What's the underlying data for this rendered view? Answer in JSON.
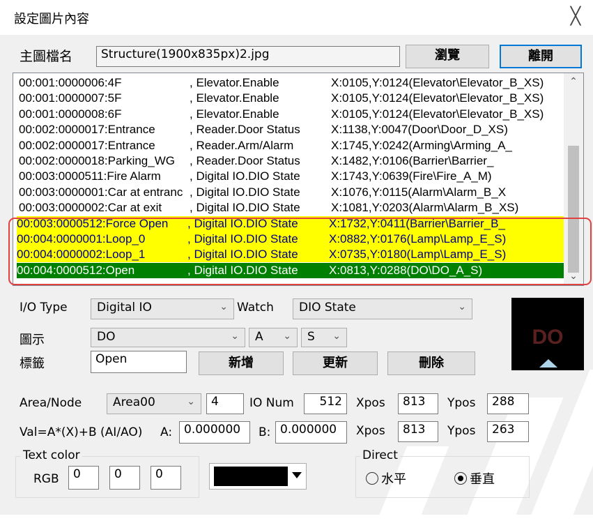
{
  "window": {
    "title": "設定圖片內容",
    "close_glyph": "╳"
  },
  "main_file": {
    "label": "主圖檔名",
    "value": "Structure(1900x835px)2.jpg",
    "browse_label": "瀏覽",
    "exit_label": "離開"
  },
  "list": {
    "rows": [
      {
        "id": "00:001:0000006:4F",
        "type": ", Elevator.Enable",
        "pos": "X:0105,Y:0124(Elevator\\Elevator_B_XS)",
        "style": "normal"
      },
      {
        "id": "00:001:0000007:5F",
        "type": ", Elevator.Enable",
        "pos": "X:0105,Y:0124(Elevator\\Elevator_B_XS)",
        "style": "normal"
      },
      {
        "id": "00:001:0000008:6F",
        "type": ", Elevator.Enable",
        "pos": "X:0105,Y:0124(Elevator\\Elevator_B_XS)",
        "style": "normal"
      },
      {
        "id": "00:002:0000017:Entrance",
        "type": ", Reader.Door Status",
        "pos": "X:1138,Y:0047(Door\\Door_D_XS)",
        "style": "normal"
      },
      {
        "id": "00:002:0000017:Entrance",
        "type": ", Reader.Arm/Alarm",
        "pos": "X:1745,Y:0242(Arming\\Arming_A_",
        "style": "normal"
      },
      {
        "id": "00:002:0000018:Parking_WG",
        "type": ", Reader.Door Status",
        "pos": "X:1482,Y:0106(Barrier\\Barrier_",
        "style": "normal"
      },
      {
        "id": "00:003:0000511:Fire Alarm",
        "type": ", Digital IO.DIO State",
        "pos": "X:1743,Y:0639(Fire\\Fire_A_M)",
        "style": "normal"
      },
      {
        "id": "00:003:0000001:Car at entranc",
        "type": ", Digital IO.DIO State",
        "pos": "X:1076,Y:0115(Alarm\\Alarm_B_X",
        "style": "normal"
      },
      {
        "id": "00:003:0000002:Car at exit",
        "type": ", Digital IO.DIO State",
        "pos": "X:1081,Y:0203(Alarm\\Alarm_B_XS)",
        "style": "normal"
      },
      {
        "id": "00:003:0000512:Force Open",
        "type": ", Digital IO.DIO State",
        "pos": "X:1732,Y:0411(Barrier\\Barrier_B_",
        "style": "yellow"
      },
      {
        "id": "00:004:0000001:Loop_0",
        "type": ", Digital IO.DIO State",
        "pos": "X:0882,Y:0176(Lamp\\Lamp_E_S)",
        "style": "yellow"
      },
      {
        "id": "00:004:0000002:Loop_1",
        "type": ", Digital IO.DIO State",
        "pos": "X:0735,Y:0180(Lamp\\Lamp_E_S)",
        "style": "yellow"
      },
      {
        "id": "00:004:0000512:Open",
        "type": ", Digital IO.DIO State",
        "pos": "X:0813,Y:0288(DO\\DO_A_S)",
        "style": "selected"
      }
    ],
    "scroll_up_glyph": "⌃",
    "scroll_down_glyph": "⌄"
  },
  "io_type": {
    "label": "I/O Type",
    "value": "Digital IO",
    "watch_label": "Watch",
    "watch_value": "DIO State"
  },
  "icon_row": {
    "label": "圖示",
    "value1": "DO",
    "value2": "A",
    "value3": "S"
  },
  "tag_row": {
    "label": "標籤",
    "value": "Open",
    "add_label": "新增",
    "update_label": "更新",
    "delete_label": "刪除"
  },
  "preview": {
    "text": "DO"
  },
  "area": {
    "label": "Area/Node",
    "area_value": "Area00",
    "node_value": "4",
    "io_num_label": "IO Num",
    "io_num_value": "512",
    "xpos_label": "Xpos",
    "xpos_value": "813",
    "ypos_label": "Ypos",
    "ypos_value": "288"
  },
  "val": {
    "label": "Val=A*(X)+B (AI/AO)",
    "a_label": "A:",
    "a_value": "0.000000",
    "b_label": "B:",
    "b_value": "0.000000",
    "xpos_label": "Xpos",
    "xpos_value": "813",
    "ypos_label": "Ypos",
    "ypos_value": "263"
  },
  "text_color": {
    "label": "Text color",
    "rgb_label": "RGB",
    "r": "0",
    "g": "0",
    "b": "0",
    "swatch_color": "#000000"
  },
  "direct": {
    "label": "Direct",
    "horizontal_label": "水平",
    "vertical_label": "垂直",
    "selected": "vertical"
  },
  "colors": {
    "yellow_row": "#ffff00",
    "selected_row": "#008000",
    "highlight_frame": "#e04040"
  },
  "dropdown_glyph": "⌄"
}
